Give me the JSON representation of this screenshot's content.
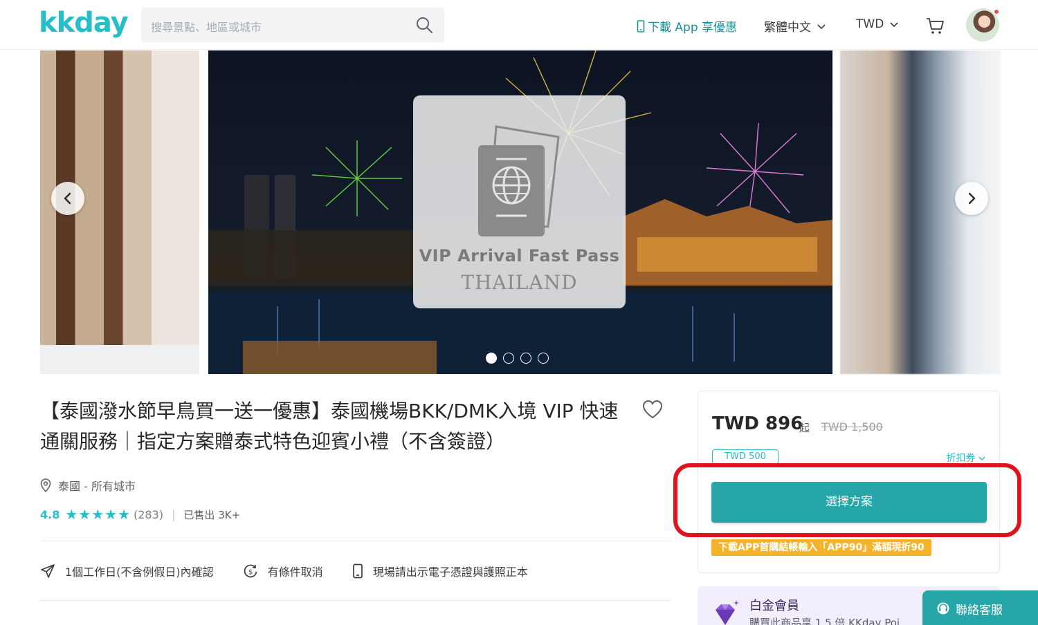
{
  "header": {
    "logo": "kkday",
    "search_placeholder": "搜尋景點、地區或城市",
    "download_app": "下載 App 享優惠",
    "language": "繁體中文",
    "currency": "TWD"
  },
  "gallery": {
    "overlay_line1": "VIP Arrival Fast Pass",
    "overlay_line2": "THAILAND",
    "slide_count": 4,
    "active_slide": 1
  },
  "product": {
    "title": "【泰國潑水節早鳥買一送一優惠】泰國機場BKK/DMK入境 VIP 快速通關服務｜指定方案贈泰式特色迎賓小禮（不含簽證）",
    "location": "泰國 - 所有城市",
    "rating": "4.8",
    "stars": "★★★★★",
    "reviews": "(283)",
    "separator": "|",
    "sold": "已售出 3K+",
    "features": [
      {
        "icon": "paper-plane-icon",
        "label": "1個工作日(不含例假日)內確認"
      },
      {
        "icon": "refund-icon",
        "label": "有條件取消"
      },
      {
        "icon": "mobile-voucher-icon",
        "label": "現場請出示電子憑證與護照正本"
      }
    ]
  },
  "price_box": {
    "price": "TWD 896",
    "from": "起",
    "original_price": "TWD 1,500",
    "coupon_badge": "TWD 500",
    "coupon_link": "折扣券",
    "select_button": "選擇方案",
    "promo": "下載APP首購結帳輸入「APP90」滿額現折90",
    "highlight_color": "#e0121e"
  },
  "membership": {
    "title": "白金會員",
    "subtitle": "購買此商品享 1.5 倍 KKday Poi"
  },
  "support": {
    "label": "聯絡客服"
  },
  "colors": {
    "brand": "#26bec9",
    "button": "#26a6a8",
    "promo": "#f5b32c"
  }
}
